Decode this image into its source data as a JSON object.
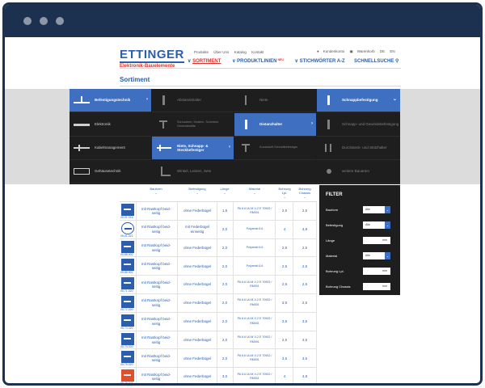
{
  "header": {
    "logo_main": "ETTINGER",
    "logo_sub": "Elektronik-Bauelemente",
    "top_links": [
      "Produkte",
      "Über Uns",
      "Katalog",
      "Kontakt"
    ],
    "util_links": [
      "Kundenkonto",
      "Warenkorb",
      "DE",
      "EN"
    ],
    "main_nav": [
      "SORTIMENT",
      "PRODUKTLINIEN",
      "STICHWÖRTER A-Z"
    ],
    "neu_badge": "NEU",
    "quick_search": "SCHNELLSUCHE"
  },
  "page_title": "Sortiment",
  "menu": {
    "col1": [
      "Befestigungstechnik",
      "Elektronik",
      "Kabelmanagement",
      "Gehäusetechnik"
    ],
    "col2": [
      "Abstandshalter",
      "Schrauben, Muttern, Scheiben, Gewindestifte",
      "Niete, Schnapp- & Steckbefestiger",
      "Winkel, Leisten, Sets"
    ],
    "col3": [
      "Niete",
      "Distanzhalter",
      "Kunststoff-Schnellbefestiger"
    ],
    "col4": [
      "Schnappbefestigung",
      "Schnapp- und Gewindebefestigung",
      "Durchsteck- und Stützhalter",
      "weitere Bauarten"
    ]
  },
  "table": {
    "headers": [
      "Bauform",
      "Befestigung",
      "Länge",
      "Material",
      "Bohrung Lpl.",
      "Bohrung Chassis"
    ],
    "rows": [
      {
        "code": "05.01.016",
        "bauform": "mit Rastkopf beid-seitig",
        "befestigung": "ohne Federbügel",
        "laenge": "1,6",
        "material": "PA 6.6 UL94 V-2 E 70902 / RM001",
        "lpl": "2,5",
        "chassis": "2,5"
      },
      {
        "code": "05.01.021",
        "bauform": "mit Rastkopf beid-seitig",
        "befestigung": "mit Federbügel einseitig",
        "laenge": "2,0",
        "material": "Polyamid 6.6",
        "lpl": "4",
        "chassis": "4,8"
      },
      {
        "code": "05.88.002",
        "bauform": "mit Rastkopf beid-seitig",
        "befestigung": "ohne Federbügel",
        "laenge": "2,0",
        "material": "Polyamid 6.6",
        "lpl": "2,5",
        "chassis": "2,5"
      },
      {
        "code": "05.88.902",
        "bauform": "mit Rastkopf beid-seitig",
        "befestigung": "ohne Federbügel",
        "laenge": "2,0",
        "material": "Polyamid 6.6",
        "lpl": "2,5",
        "chassis": "2,5"
      },
      {
        "code": "05.71.020",
        "bauform": "mit Rastkopf beid-seitig",
        "befestigung": "ohne Federbügel",
        "laenge": "2,0",
        "material": "PA 6.6 UL94 V-2 E 70902 / RM001",
        "lpl": "2,5",
        "chassis": "2,5"
      },
      {
        "code": "05.72.020",
        "bauform": "mit Rastkopf beid-seitig",
        "befestigung": "ohne Federbügel",
        "laenge": "2,0",
        "material": "PA 6.6 UL94 V-2 E 70902 / RM001",
        "lpl": "3,5",
        "chassis": "2,5"
      },
      {
        "code": "05.73.020",
        "bauform": "mit Rastkopf beid-seitig",
        "befestigung": "ohne Federbügel",
        "laenge": "2,0",
        "material": "PA 6.6 UL94 V-2 E 70902 / RM001",
        "lpl": "3,5",
        "chassis": "3,5"
      },
      {
        "code": "05.74.020",
        "bauform": "mit Rastkopf beid-seitig",
        "befestigung": "ohne Federbügel",
        "laenge": "2,0",
        "material": "PA 6.6 UL94 V-2 E 70902 / RM001",
        "lpl": "2,5",
        "chassis": "3,5"
      },
      {
        "code": "05.75.020",
        "bauform": "mit Rastkopf beid-seitig",
        "befestigung": "ohne Federbügel",
        "laenge": "2,0",
        "material": "PA 6.6 UL94 V-2 E 70902 / RM001",
        "lpl": "3,5",
        "chassis": "3,5"
      },
      {
        "code": "05.76.021",
        "bauform": "mit Rastkopf beid-seitig",
        "befestigung": "ohne Federbügel",
        "laenge": "3,0",
        "material": "PA 6.6 UL94 V-2 E 70902 / RM001",
        "lpl": "4",
        "chassis": "4,8"
      }
    ]
  },
  "filter": {
    "title": "FILTER",
    "rows": [
      {
        "label": "Bauform",
        "value": "Alle",
        "type": "select"
      },
      {
        "label": "Befestigung",
        "value": "Alle",
        "type": "select"
      },
      {
        "label": "Länge",
        "value": "mm",
        "type": "text"
      },
      {
        "label": "Material",
        "value": "Alle",
        "type": "select"
      },
      {
        "label": "Bohrung Lpl.",
        "value": "mm",
        "type": "text"
      },
      {
        "label": "Bohrung Chassis",
        "value": "mm",
        "type": "text"
      }
    ]
  },
  "colors": {
    "brand_blue": "#2b5fae",
    "brand_red": "#e0312b",
    "menu_dark": "#1e1e1e",
    "menu_active": "#3e6fc0",
    "frame": "#1c3050"
  }
}
